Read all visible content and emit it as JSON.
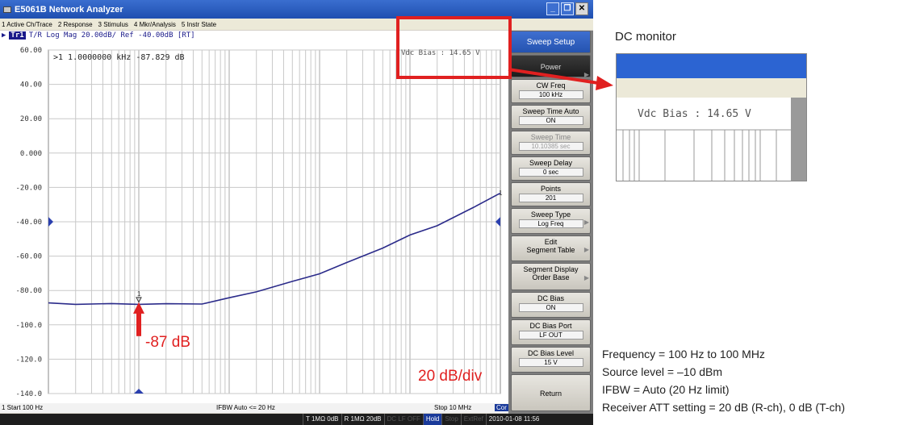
{
  "window": {
    "title": "E5061B Network Analyzer",
    "menu": [
      "1 Active Ch/Trace",
      "2 Response",
      "3 Stimulus",
      "4 Mkr/Analysis",
      "5 Instr State"
    ]
  },
  "trace": {
    "badge": "Tr1",
    "label": "T/R Log Mag 20.00dB/ Ref -40.00dB [RT]",
    "marker_readout": ">1  1.0000000 kHz -87.829 dB",
    "vdc_bias": "Vdc Bias :  14.65  V",
    "marker_label": "1",
    "end_marker_label": "1",
    "y_ticks": [
      "60.00",
      "40.00",
      "20.00",
      "0.000",
      "-20.00",
      "-40.00",
      "-60.00",
      "-80.00",
      "-100.0",
      "-120.0",
      "-140.0"
    ]
  },
  "chart_data": {
    "type": "line",
    "title": "",
    "xlabel": "",
    "ylabel": "",
    "x_scale": "log",
    "xlim": [
      100,
      10000000
    ],
    "ylim": [
      -140,
      60
    ],
    "grid": true,
    "series": [
      {
        "x": [
          100,
          200,
          500,
          1000,
          2000,
          5000,
          10000,
          20000,
          50000,
          100000,
          200000,
          500000,
          1000000,
          2000000,
          5000000,
          10000000
        ],
        "values": [
          -87.5,
          -87.8,
          -87.9,
          -87.8,
          -88.0,
          -87.6,
          -84.5,
          -80.5,
          -75.0,
          -70.0,
          -64.0,
          -55.0,
          -48.0,
          -42.0,
          -32.0,
          -23.0
        ]
      }
    ]
  },
  "status": {
    "start": "1  Start 100 Hz",
    "ifbw": "IFBW Auto <= 20 Hz",
    "stop": "Stop 10 MHz",
    "cor": "Cor",
    "items": [
      "T 1MΩ 0dB",
      "R 1MΩ 20dB",
      "DC LF OFF",
      "Hold",
      "Stop",
      "ExtRef",
      "2010-01-08 11:56"
    ]
  },
  "softkeys": {
    "sweep_setup": "Sweep Setup",
    "power": "Power",
    "cw_freq": {
      "label": "CW Freq",
      "value": "100 kHz"
    },
    "sweep_time_auto": {
      "label": "Sweep Time Auto",
      "value": "ON"
    },
    "sweep_time": {
      "label": "Sweep Time",
      "value": "10.10385 sec"
    },
    "sweep_delay": {
      "label": "Sweep Delay",
      "value": "0 sec"
    },
    "points": {
      "label": "Points",
      "value": "201"
    },
    "sweep_type": {
      "label": "Sweep Type",
      "value": "Log Freq"
    },
    "edit": {
      "label": "Edit",
      "value": "Segment Table"
    },
    "segment_display": {
      "label": "Segment Display",
      "value": "Order Base"
    },
    "dc_bias": {
      "label": "DC Bias",
      "value": "ON"
    },
    "dc_bias_port": {
      "label": "DC Bias Port",
      "value": "LF OUT"
    },
    "dc_bias_level": {
      "label": "DC Bias Level",
      "value": "15 V"
    },
    "return": "Return"
  },
  "annotations": {
    "marker_value": "-87 dB",
    "scale": "20 dB/div",
    "dc_monitor_title": "DC monitor",
    "dc_monitor_value": "Vdc Bias :    14.65   V",
    "conditions": [
      "Frequency = 100 Hz to 100 MHz",
      "Source level = –10 dBm",
      "IFBW = Auto (20 Hz limit)",
      "Receiver ATT setting = 20 dB (R-ch), 0 dB (T-ch)"
    ]
  },
  "colors": {
    "trace": "#2b2b8a",
    "annotation_red": "#e02020",
    "titlebar": "#2a5cc0"
  }
}
